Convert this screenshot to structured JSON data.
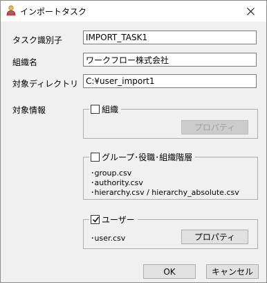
{
  "window": {
    "title": "インポートタスク",
    "close_glyph": "✕"
  },
  "form": {
    "task_id_label": "タスク識別子",
    "task_id_value": "IMPORT_TASK1",
    "org_name_label": "組織名",
    "org_name_value": "ワークフロー株式会社",
    "target_dir_label": "対象ディレクトリ",
    "target_dir_value": "C:¥user_import1",
    "target_info_label": "対象情報"
  },
  "groups": {
    "org": {
      "label": "組織",
      "checked": false,
      "property_button": "プロパティ"
    },
    "group_role": {
      "label": "グループ･役職･組織階層",
      "checked": false,
      "files": [
        "･group.csv",
        "･authority.csv",
        "･hierarchy.csv / hierarchy_absolute.csv"
      ]
    },
    "user": {
      "label": "ユーザー",
      "checked": true,
      "files": [
        "･user.csv"
      ],
      "property_button": "プロパティ"
    }
  },
  "buttons": {
    "ok": "OK",
    "cancel": "キャンセル"
  }
}
